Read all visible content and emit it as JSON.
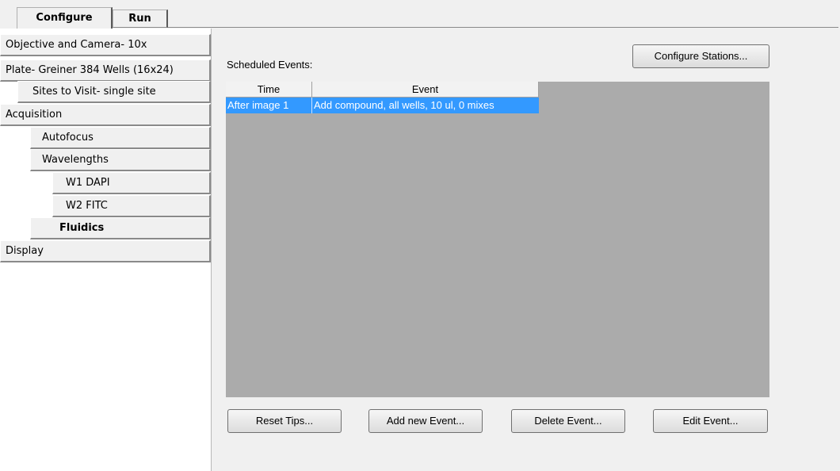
{
  "tabs": [
    {
      "label": "Configure"
    },
    {
      "label": "Run"
    }
  ],
  "sidebar": {
    "items": [
      {
        "label": "Objective and Camera- 10x"
      },
      {
        "label": "Plate- Greiner 384 Wells (16x24)"
      },
      {
        "label": "Sites to Visit- single site"
      },
      {
        "label": "Acquisition"
      },
      {
        "label": "Autofocus"
      },
      {
        "label": "Wavelengths"
      },
      {
        "label": "W1 DAPI"
      },
      {
        "label": "W2 FITC"
      },
      {
        "label": "Fluidics"
      },
      {
        "label": "Display"
      }
    ],
    "selected": "Fluidics"
  },
  "main": {
    "configure_stations_label": "Configure Stations...",
    "scheduled_events_label": "Scheduled Events:",
    "table": {
      "columns": [
        "Time",
        "Event"
      ],
      "rows": [
        {
          "time": "After image 1",
          "event": "Add compound, all wells, 10 ul, 0 mixes",
          "selected": true
        }
      ]
    },
    "buttons": {
      "reset_tips": "Reset Tips...",
      "add_event": "Add new Event...",
      "delete_event": "Delete Event...",
      "edit_event": "Edit Event..."
    }
  },
  "colors": {
    "selection": "#3399ff",
    "table_background": "#ababab",
    "window_background": "#f0f0f0"
  }
}
